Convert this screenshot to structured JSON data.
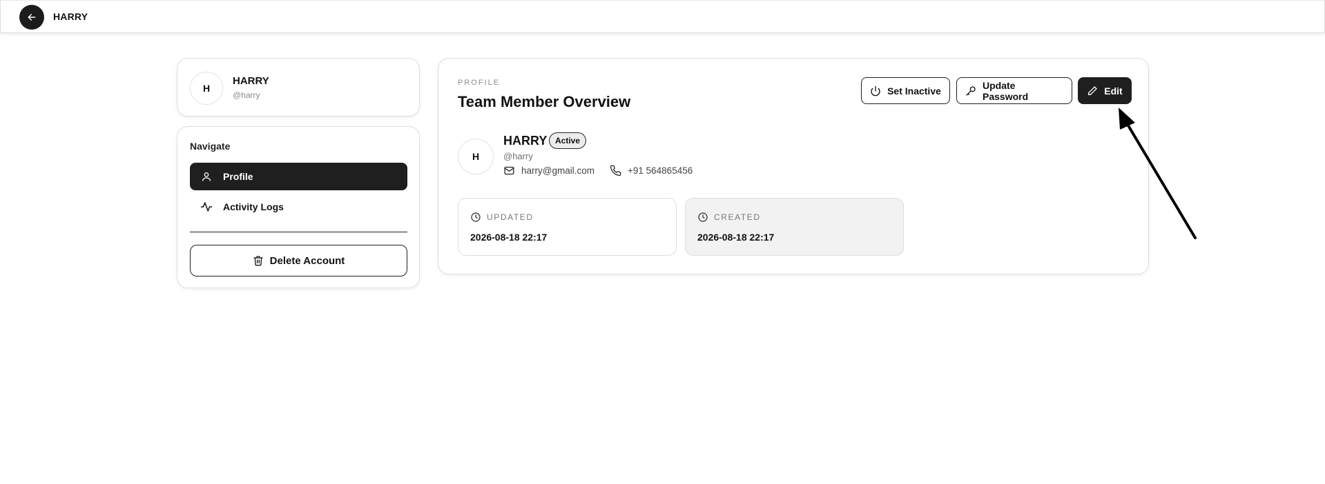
{
  "header": {
    "title": "HARRY",
    "back_icon": "arrow-left-icon"
  },
  "sidebar": {
    "user": {
      "avatar_initial": "H",
      "name": "HARRY",
      "handle": "@harry"
    },
    "nav_heading": "Navigate",
    "items": [
      {
        "label": "Profile",
        "icon": "user-icon",
        "active": true
      },
      {
        "label": "Activity Logs",
        "icon": "activity-icon",
        "active": false
      }
    ],
    "delete_label": "Delete Account",
    "delete_icon": "trash-icon"
  },
  "main": {
    "eyebrow": "PROFILE",
    "title": "Team Member Overview",
    "actions": {
      "set_inactive": "Set Inactive",
      "update_password": "Update Password",
      "edit": "Edit"
    },
    "member": {
      "avatar_initial": "H",
      "name": "HARRY",
      "status": "Active",
      "handle": "@harry",
      "email": "harry@gmail.com",
      "phone": "+91 564865456"
    },
    "stats": {
      "updated_label": "UPDATED",
      "updated_value": "2026-08-18 22:17",
      "created_label": "CREATED",
      "created_value": "2026-08-18 22:17"
    }
  },
  "colors": {
    "primary_dark": "#1f1f1f",
    "border": "#dedede",
    "muted_text": "#8a8a8a",
    "created_bg": "#f2f2f2"
  }
}
